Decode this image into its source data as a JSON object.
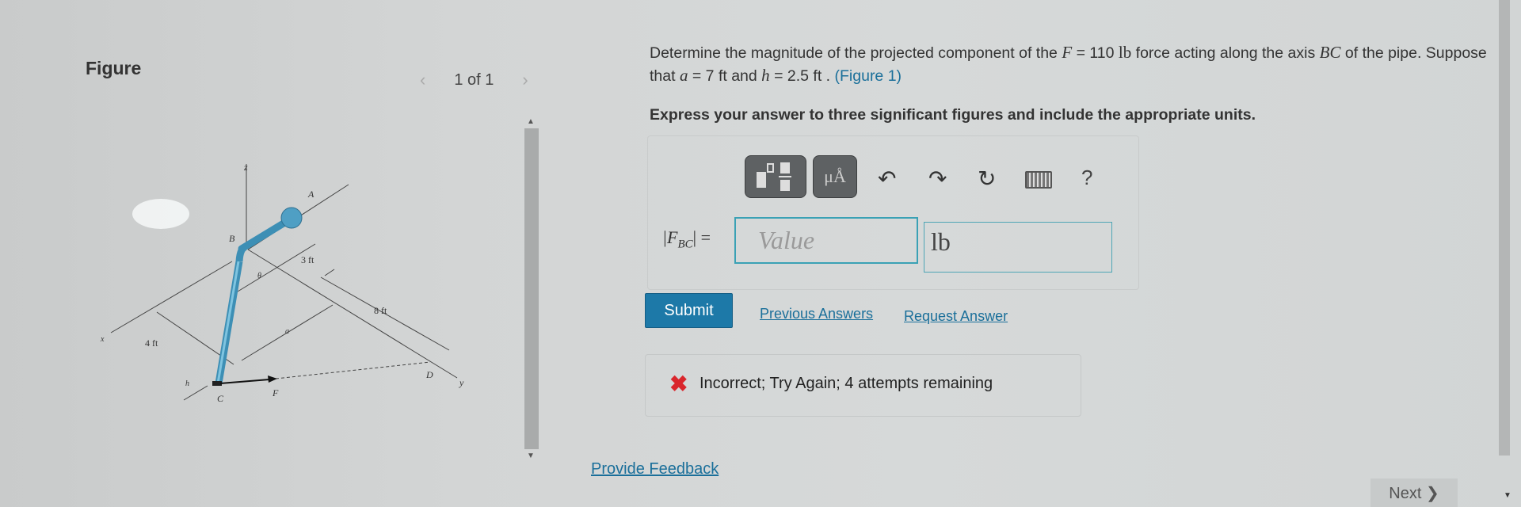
{
  "figure_panel": {
    "title": "Figure",
    "pager": "1 of 1",
    "prev_icon": "chevron-left-icon",
    "next_icon": "chevron-right-icon",
    "labels": {
      "z": "z",
      "A": "A",
      "B": "B",
      "three_ft": "3 ft",
      "theta": "θ",
      "eight_ft": "8 ft",
      "a": "a",
      "x": "x",
      "four_ft": "4 ft",
      "h": "h",
      "C": "C",
      "F": "F",
      "D": "D",
      "y": "y"
    },
    "pipe_color": "#5aaed0"
  },
  "question": {
    "line1_a": "Determine the magnitude of the projected component of the ",
    "F": "F",
    "line1_b": " = 110 ",
    "lb": "lb",
    "line1_c": " force acting along the axis ",
    "BC": "BC",
    "line1_d": " of the pipe. Suppose that ",
    "a": "a",
    "a_val": " = 7 ft",
    "and": " and ",
    "h": "h",
    "h_val": " = 2.5 ft",
    "dot": " . ",
    "figure_link": "(Figure 1)",
    "instruction": "Express your answer to three significant figures and include the appropriate units."
  },
  "answer": {
    "toolbar": {
      "templates_icon": "fraction-template-icon",
      "units_label": "μÅ",
      "undo_icon": "undo-icon",
      "redo_icon": "redo-icon",
      "reset_icon": "reset-icon",
      "keyboard_icon": "keyboard-icon",
      "help_label": "?"
    },
    "label_main": "|F",
    "label_sub": "BC",
    "label_end": "| =",
    "value_placeholder": "Value",
    "value": "",
    "units_value": "lb"
  },
  "actions": {
    "submit": "Submit",
    "previous_answers": "Previous Answers",
    "request_answer": "Request Answer"
  },
  "feedback": {
    "icon": "x-icon",
    "message": "Incorrect; Try Again; 4 attempts remaining",
    "color": "#d9262c"
  },
  "footer": {
    "provide_feedback": "Provide Feedback",
    "next": "Next ❯"
  },
  "colors": {
    "accent": "#1d79a8",
    "link": "#1a6f9a",
    "input_border": "#3aa1b5"
  }
}
